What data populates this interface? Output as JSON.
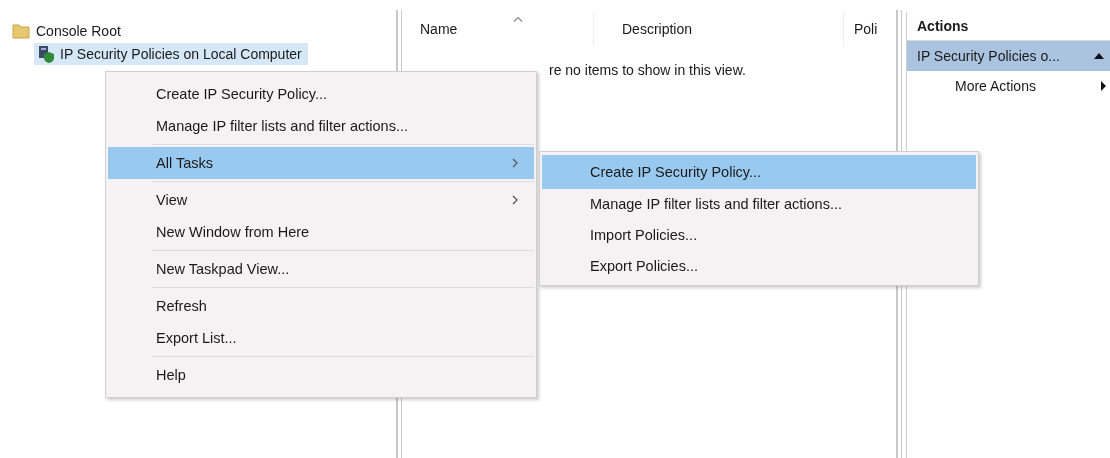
{
  "tree": [
    {
      "label": "Console Root",
      "selected": false,
      "children": [
        {
          "label": "IP Security Policies on Local Computer",
          "selected": true
        }
      ]
    }
  ],
  "list": {
    "columns": [
      {
        "label": "Name",
        "sorted": true
      },
      {
        "label": "Description",
        "sorted": false
      },
      {
        "label": "Poli",
        "sorted": false
      }
    ],
    "empty_message": "re no items to show in this view."
  },
  "actions": {
    "title": "Actions",
    "sections": [
      {
        "label": "IP Security Policies o...",
        "expanded": true,
        "items": [
          {
            "label": "More Actions",
            "has_submenu": true
          }
        ]
      }
    ]
  },
  "context_menu": {
    "items": [
      {
        "kind": "item",
        "label": "Create IP Security Policy...",
        "has_submenu": false,
        "selected": false
      },
      {
        "kind": "item",
        "label": "Manage IP filter lists and filter actions...",
        "has_submenu": false,
        "selected": false
      },
      {
        "kind": "separator"
      },
      {
        "kind": "item",
        "label": "All Tasks",
        "has_submenu": true,
        "selected": true
      },
      {
        "kind": "separator"
      },
      {
        "kind": "item",
        "label": "View",
        "has_submenu": true,
        "selected": false
      },
      {
        "kind": "item",
        "label": "New Window from Here",
        "has_submenu": false,
        "selected": false
      },
      {
        "kind": "separator"
      },
      {
        "kind": "item",
        "label": "New Taskpad View...",
        "has_submenu": false,
        "selected": false
      },
      {
        "kind": "separator"
      },
      {
        "kind": "item",
        "label": "Refresh",
        "has_submenu": false,
        "selected": false
      },
      {
        "kind": "item",
        "label": "Export List...",
        "has_submenu": false,
        "selected": false
      },
      {
        "kind": "separator"
      },
      {
        "kind": "item",
        "label": "Help",
        "has_submenu": false,
        "selected": false
      }
    ]
  },
  "submenu": {
    "items": [
      {
        "label": "Create IP Security Policy...",
        "selected": true
      },
      {
        "label": "Manage IP filter lists and filter actions...",
        "selected": false
      },
      {
        "label": "Import Policies...",
        "selected": false
      },
      {
        "label": "Export Policies...",
        "selected": false
      }
    ]
  }
}
